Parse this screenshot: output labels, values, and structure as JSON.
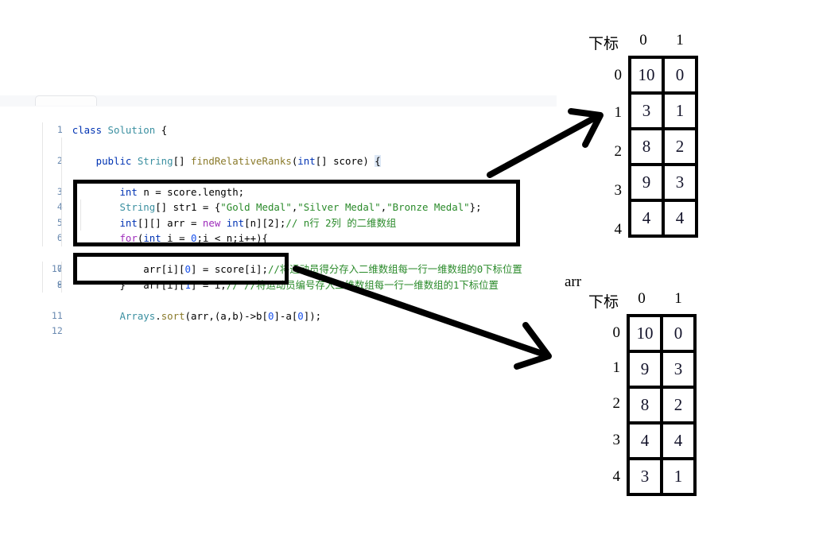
{
  "editor": {
    "lines": [
      {
        "n": "1",
        "indent": 0,
        "code": "class Solution {"
      },
      {
        "n": "2",
        "indent": 1,
        "code": "public String[] findRelativeRanks(int[] score) {"
      },
      {
        "n": "3",
        "indent": 2,
        "code": "int n = score.length;"
      },
      {
        "n": "4",
        "indent": 2,
        "code": "String[] str1 = {\"Gold Medal\",\"Silver Medal\",\"Bronze Medal\"};"
      },
      {
        "n": "5",
        "indent": 2,
        "code": "int[][] arr = new int[n][2];// n行 2列 的二维数组"
      },
      {
        "n": "6",
        "indent": 2,
        "code": "for(int i = 0;i < n;i++){"
      },
      {
        "n": "7",
        "indent": 3,
        "code": "arr[i][0] = score[i];//将运动员得分存入二维数组每一行一维数组的0下标位置"
      },
      {
        "n": "8",
        "indent": 3,
        "code": "arr[i][1] = i;// //将运动员编号存入二维数组每一行一维数组的1下标位置"
      },
      {
        "n": "9",
        "indent": 2,
        "code": "}"
      },
      {
        "n": "10",
        "indent": 0,
        "code": ""
      },
      {
        "n": "11",
        "indent": 2,
        "code": "Arrays.sort(arr,(a,b)->b[0]-a[0]);"
      },
      {
        "n": "12",
        "indent": 0,
        "code": ""
      }
    ],
    "highlight_boxes": [
      {
        "name": "for-loop-box",
        "lines": "6-9"
      },
      {
        "name": "arrays-sort-box",
        "lines": "11"
      }
    ]
  },
  "annotations": {
    "arrow_to_table_before": "arrow-pointing-to-before-sort-matrix",
    "arrow_to_table_after": "arrow-pointing-to-after-sort-matrix"
  },
  "matrix_before": {
    "name": "",
    "index_label": "下标",
    "col_headers": [
      "0",
      "1"
    ],
    "row_headers": [
      "0",
      "1",
      "2",
      "3",
      "4"
    ],
    "rows": [
      [
        "10",
        "0"
      ],
      [
        "3",
        "1"
      ],
      [
        "8",
        "2"
      ],
      [
        "9",
        "3"
      ],
      [
        "4",
        "4"
      ]
    ]
  },
  "matrix_after": {
    "name": "arr",
    "index_label": "下标",
    "col_headers": [
      "0",
      "1"
    ],
    "row_headers": [
      "0",
      "1",
      "2",
      "3",
      "4"
    ],
    "rows": [
      [
        "10",
        "0"
      ],
      [
        "9",
        "3"
      ],
      [
        "8",
        "2"
      ],
      [
        "4",
        "4"
      ],
      [
        "3",
        "1"
      ]
    ]
  },
  "colors": {
    "keyword": "#0033b3",
    "keyword_alt": "#9e2cbb",
    "type": "#3a8fa0",
    "method": "#8a7a2a",
    "string": "#2a8a2a",
    "comment": "#2a8a2a",
    "gutter": "#6a8ab0",
    "annotation": "#000000",
    "background": "#ffffff"
  }
}
